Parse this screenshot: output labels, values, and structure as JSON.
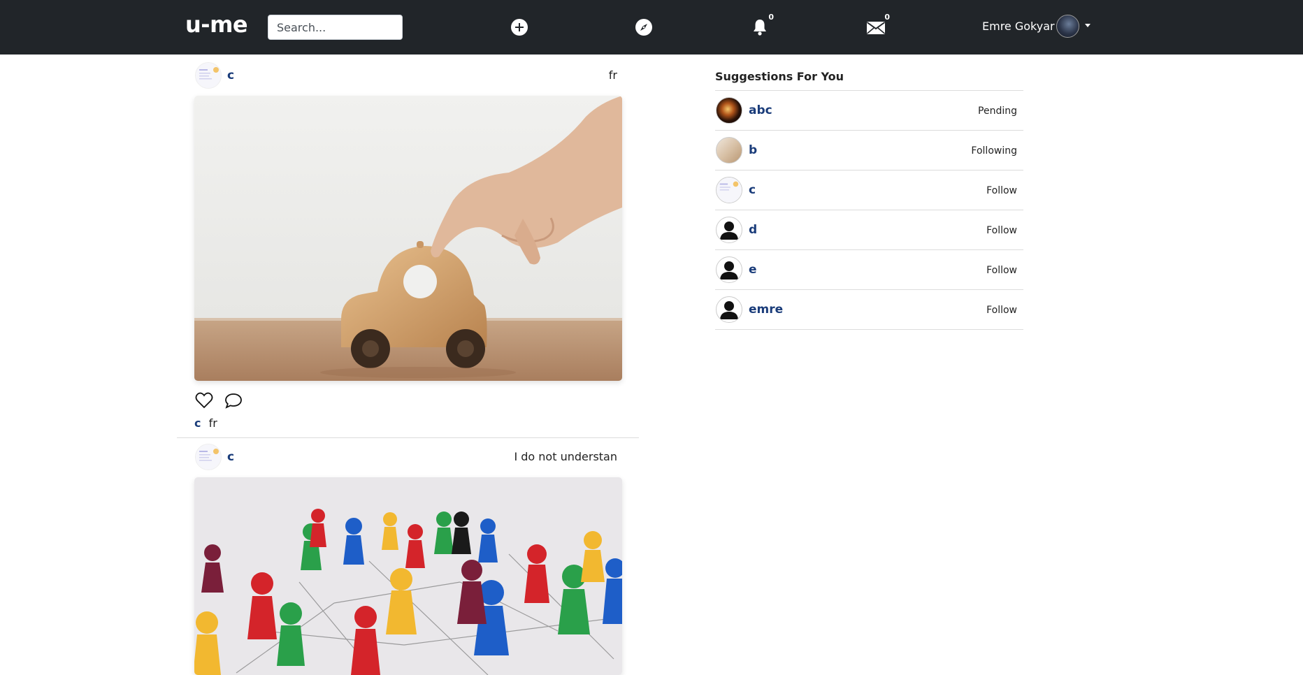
{
  "navbar": {
    "brand": "u-me",
    "search_placeholder": "Search...",
    "notifications_count": "0",
    "messages_count": "0",
    "user_name": "Emre Gokyar",
    "icons": [
      "plus-circle-icon",
      "compass-icon",
      "bell-icon",
      "envelope-icon"
    ]
  },
  "feed": {
    "posts": [
      {
        "author": "c",
        "caption": "fr",
        "image": "wooden-toy-car-photo"
      },
      {
        "author": "c",
        "caption": "I do not understan",
        "image": "game-pieces-network-photo"
      }
    ]
  },
  "suggestions": {
    "title": "Suggestions For You",
    "items": [
      {
        "name": "abc",
        "status": "Pending"
      },
      {
        "name": "b",
        "status": "Following"
      },
      {
        "name": "c",
        "status": "Follow"
      },
      {
        "name": "d",
        "status": "Follow"
      },
      {
        "name": "e",
        "status": "Follow"
      },
      {
        "name": "emre",
        "status": "Follow"
      }
    ]
  },
  "colors": {
    "navbar_bg": "#212529",
    "link": "#1a3c7a"
  }
}
